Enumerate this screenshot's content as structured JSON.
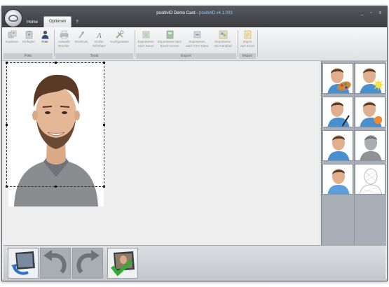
{
  "window": {
    "title_main": "positivID Demo Card",
    "title_separator": " - ",
    "title_version": "positivID v4.1.003",
    "controls": {
      "minimize": "_",
      "maximize": "▫",
      "close": "x"
    }
  },
  "tabs": [
    {
      "label": "Home",
      "active": false
    },
    {
      "label": "Optionen",
      "active": true
    },
    {
      "label": "?",
      "active": false
    }
  ],
  "ribbon": {
    "groups": [
      {
        "label": "Foto",
        "buttons": [
          {
            "label": "Kopieren",
            "icon": "copy-icon",
            "enabled": false
          },
          {
            "label": "Einfügen",
            "icon": "paste-icon",
            "enabled": false
          },
          {
            "label": "Foto",
            "icon": "person-photo-icon",
            "enabled": true
          }
        ]
      },
      {
        "label": "Tools",
        "buttons": [
          {
            "label": "Auswahl\nDrucker",
            "icon": "printer-icon",
            "enabled": false
          },
          {
            "label": "Shortcuts",
            "icon": "shortcut-icon",
            "enabled": false
          },
          {
            "label": "Große\nSchriftart",
            "icon": "font-icon",
            "enabled": false
          },
          {
            "label": "Konfiguration",
            "icon": "tools-icon",
            "enabled": false
          }
        ]
      },
      {
        "label": "Export",
        "buttons": [
          {
            "label": "Exportieren\nnach Excel",
            "icon": "export-excel-icon",
            "enabled": false
          },
          {
            "label": "Exportieren nach\nExcel Access",
            "icon": "export-access-icon",
            "enabled": false
          },
          {
            "label": "Exportieren\nnach CSV Datei",
            "icon": "export-csv-icon",
            "enabled": false
          },
          {
            "label": "Exportieren\nmit Fotopfad",
            "icon": "export-photo-path-icon",
            "enabled": false
          }
        ]
      },
      {
        "label": "Import",
        "buttons": [
          {
            "label": "Import\naus Excel",
            "icon": "import-excel-icon",
            "enabled": false
          }
        ]
      }
    ]
  },
  "side_panel": {
    "avatars": [
      {
        "icon": "avatar-paint-icon"
      },
      {
        "icon": "avatar-light-icon"
      },
      {
        "icon": "avatar-pen-icon"
      },
      {
        "icon": "avatar-orange-icon"
      },
      {
        "icon": "avatar-blue-icon"
      },
      {
        "icon": "avatar-gray-icon"
      },
      {
        "icon": "avatar-default-icon"
      },
      {
        "icon": "avatar-wireframe-icon"
      }
    ]
  },
  "bottom_bar": {
    "buttons": [
      {
        "icon": "load-photo-icon",
        "enabled": true
      },
      {
        "icon": "undo-icon",
        "enabled": false
      },
      {
        "icon": "redo-icon",
        "enabled": false
      },
      {
        "icon": "accept-photo-icon",
        "enabled": true
      }
    ]
  },
  "colors": {
    "titlebar": "#3f4247",
    "ribbon_group_label": "#c9ccd0",
    "side_panel": "#a8afb7",
    "version_text": "#8fd0ff"
  }
}
